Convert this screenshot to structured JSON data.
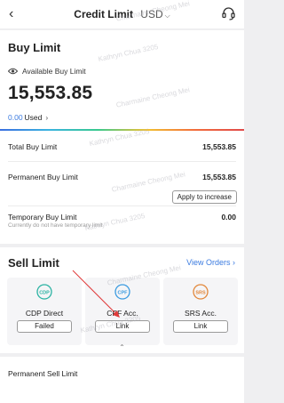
{
  "header": {
    "title": "Credit Limit",
    "currency": "USD"
  },
  "buy_limit": {
    "title": "Buy Limit",
    "available_label": "Available Buy Limit",
    "available_value": "15,553.85",
    "used_value": "0.00",
    "used_label": "Used"
  },
  "limits": {
    "total_label": "Total Buy Limit",
    "total_value": "15,553.85",
    "permanent_label": "Permanent Buy Limit",
    "permanent_value": "15,553.85",
    "apply_button": "Apply to increase",
    "temporary_label": "Temporary Buy Limit",
    "temporary_value": "0.00",
    "temporary_note": "Currently do not have temporary limit"
  },
  "sell_limit": {
    "title": "Sell Limit",
    "view_orders": "View Orders",
    "accounts": [
      {
        "icon_text": "CDP",
        "name": "CDP Direct",
        "button": "Failed",
        "color": "#2bb3a3"
      },
      {
        "icon_text": "CPF",
        "name": "CPF Acc.",
        "button": "Link",
        "color": "#3b9be0"
      },
      {
        "icon_text": "SRS",
        "name": "SRS Acc.",
        "button": "Link",
        "color": "#e2873a"
      }
    ]
  },
  "permanent_sell": {
    "label": "Permanent Sell Limit"
  },
  "watermark": "Kathryn Chua 3205",
  "watermark_alt": "Charmaine Cheong Mei",
  "colors": {
    "accent": "#3b7be0",
    "text": "#222222",
    "muted": "#9a9a9a"
  }
}
